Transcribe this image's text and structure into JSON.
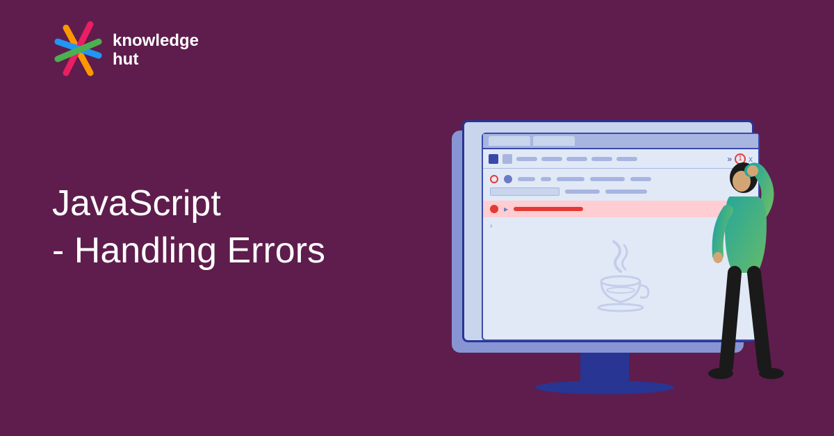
{
  "logo": {
    "line1": "knowledge",
    "line2": "hut"
  },
  "title": {
    "line1": "JavaScript",
    "line2": "- Handling Errors"
  },
  "illustration": {
    "error_count": "1",
    "close_label": "x",
    "chevron": "»"
  },
  "colors": {
    "background": "#5e1d4c",
    "text": "#ffffff",
    "monitor_primary": "#283593",
    "monitor_secondary": "#8795d4",
    "error": "#e53935",
    "person_shirt_start": "#26a69a",
    "person_shirt_end": "#66bb6a"
  }
}
